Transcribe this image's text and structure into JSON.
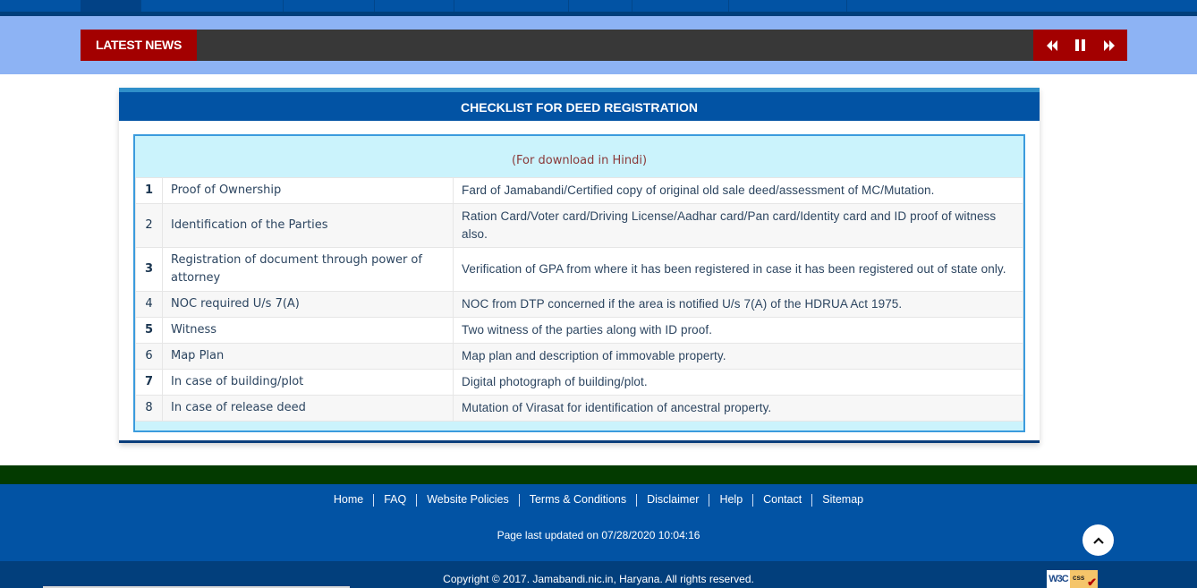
{
  "top_nav": {
    "tabs": [
      {
        "label": "",
        "active": true
      },
      {
        "label": "",
        "active": false
      },
      {
        "label": "",
        "active": false
      },
      {
        "label": "",
        "active": false
      },
      {
        "label": "",
        "active": false
      },
      {
        "label": "",
        "active": false
      },
      {
        "label": "",
        "active": false
      },
      {
        "label": "",
        "active": false
      },
      {
        "label": "",
        "active": false
      }
    ]
  },
  "news": {
    "label": "LATEST NEWS",
    "controls": {
      "previous_icon": "rewind-icon",
      "pause_icon": "pause-icon",
      "next_icon": "fast-forward-icon"
    }
  },
  "checklist": {
    "title": "CHECKLIST FOR DEED REGISTRATION",
    "hindi_download_link": "(For download in Hindi)",
    "rows": [
      {
        "num": "1",
        "item": "Proof of Ownership",
        "desc": "Fard of Jamabandi/Certified copy of original old sale deed/assessment of MC/Mutation."
      },
      {
        "num": "2",
        "item": "Identification of the Parties",
        "desc": "Ration Card/Voter card/Driving License/Aadhar card/Pan card/Identity card and ID proof of witness also."
      },
      {
        "num": "3",
        "item": "Registration of document through power of attorney",
        "desc": "Verification of GPA from where it has been registered in case it has been registered out of state only."
      },
      {
        "num": "4",
        "item": "NOC required U/s 7(A)",
        "desc": "NOC from DTP concerned if the area is notified U/s 7(A) of the HDRUA Act 1975."
      },
      {
        "num": "5",
        "item": "Witness",
        "desc": "Two witness of the parties along with ID proof."
      },
      {
        "num": "6",
        "item": "Map Plan",
        "desc": "Map plan and description of immovable property."
      },
      {
        "num": "7",
        "item": "In case of building/plot",
        "desc": "Digital photograph of building/plot."
      },
      {
        "num": "8",
        "item": "In case of release deed",
        "desc": "Mutation of Virasat for identification of ancestral property."
      }
    ]
  },
  "footer": {
    "links": [
      "Home",
      "FAQ",
      "Website Policies",
      "Terms & Conditions",
      "Disclaimer",
      "Help",
      "Contact",
      "Sitemap"
    ],
    "last_updated": "Page last updated on 07/28/2020 10:04:16",
    "back_to_top_icon": "chevron-up-icon",
    "copyright": "Copyright © 2017.  Jamabandi.nic.in, Haryana. All rights reserved.",
    "badge": {
      "w3c": "W3C",
      "css": "css"
    }
  },
  "colors": {
    "primary_blue": "#0253a4",
    "news_red": "#a30000",
    "news_bg": "#8db3f4",
    "ticker_dark": "#383838",
    "table_tint": "#cbf3fc",
    "footer_green": "#033a00"
  }
}
